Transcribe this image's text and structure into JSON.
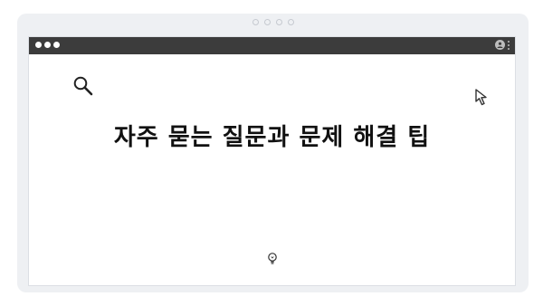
{
  "page": {
    "heading": "자주 묻는 질문과 문제 해결 팁"
  },
  "icons": {
    "search": "search-icon",
    "cursor": "cursor-arrow-icon",
    "lightbulb": "lightbulb-icon",
    "profile": "profile-icon",
    "menu": "kebab-menu-icon"
  },
  "colors": {
    "toolbar": "#3c3c3c",
    "frame": "#eef0f3",
    "text": "#111111"
  }
}
